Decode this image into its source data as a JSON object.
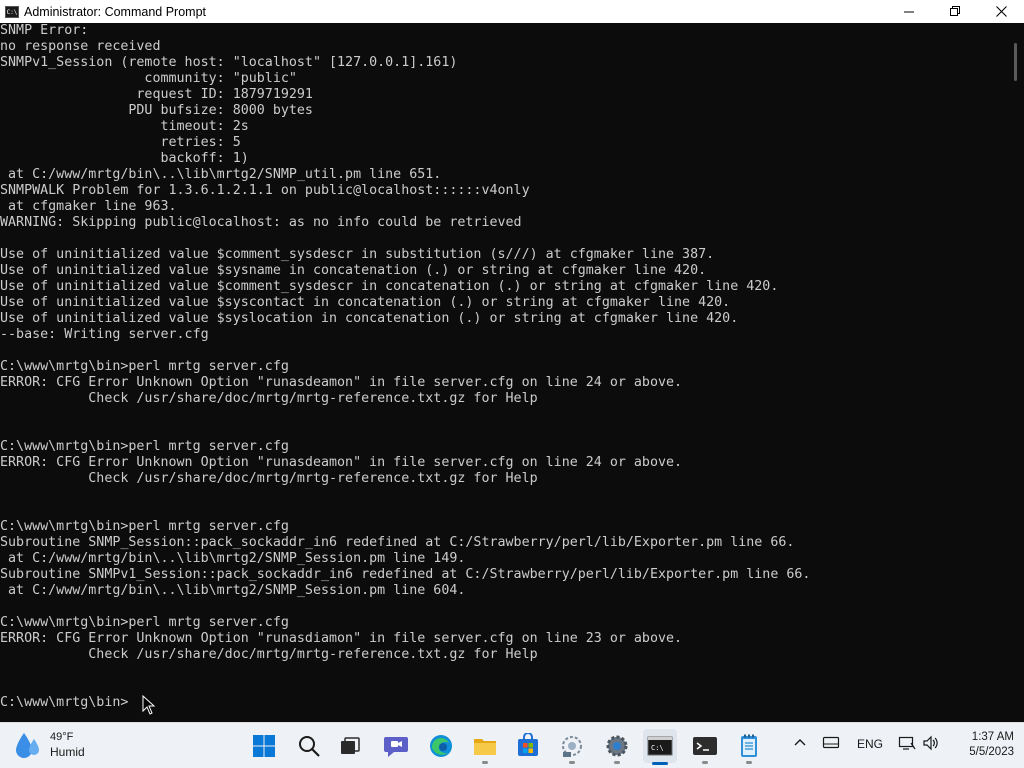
{
  "window": {
    "title": "Administrator: Command Prompt",
    "app_icon_text": "C:\\",
    "minimize": "—",
    "maximize": "❐",
    "close": "✕"
  },
  "console": {
    "lines": [
      "SNMP Error:",
      "no response received",
      "SNMPv1_Session (remote host: \"localhost\" [127.0.0.1].161)",
      "                  community: \"public\"",
      "                 request ID: 1879719291",
      "                PDU bufsize: 8000 bytes",
      "                    timeout: 2s",
      "                    retries: 5",
      "                    backoff: 1)",
      " at C:/www/mrtg/bin\\..\\lib\\mrtg2/SNMP_util.pm line 651.",
      "SNMPWALK Problem for 1.3.6.1.2.1.1 on public@localhost::::::v4only",
      " at cfgmaker line 963.",
      "WARNING: Skipping public@localhost: as no info could be retrieved",
      "",
      "Use of uninitialized value $comment_sysdescr in substitution (s///) at cfgmaker line 387.",
      "Use of uninitialized value $sysname in concatenation (.) or string at cfgmaker line 420.",
      "Use of uninitialized value $comment_sysdescr in concatenation (.) or string at cfgmaker line 420.",
      "Use of uninitialized value $syscontact in concatenation (.) or string at cfgmaker line 420.",
      "Use of uninitialized value $syslocation in concatenation (.) or string at cfgmaker line 420.",
      "--base: Writing server.cfg",
      "",
      "C:\\www\\mrtg\\bin>perl mrtg server.cfg",
      "ERROR: CFG Error Unknown Option \"runasdeamon\" in file server.cfg on line 24 or above.",
      "           Check /usr/share/doc/mrtg/mrtg-reference.txt.gz for Help",
      "",
      "",
      "C:\\www\\mrtg\\bin>perl mrtg server.cfg",
      "ERROR: CFG Error Unknown Option \"runasdeamon\" in file server.cfg on line 24 or above.",
      "           Check /usr/share/doc/mrtg/mrtg-reference.txt.gz for Help",
      "",
      "",
      "C:\\www\\mrtg\\bin>perl mrtg server.cfg",
      "Subroutine SNMP_Session::pack_sockaddr_in6 redefined at C:/Strawberry/perl/lib/Exporter.pm line 66.",
      " at C:/www/mrtg/bin\\..\\lib\\mrtg2/SNMP_Session.pm line 149.",
      "Subroutine SNMPv1_Session::pack_sockaddr_in6 redefined at C:/Strawberry/perl/lib/Exporter.pm line 66.",
      " at C:/www/mrtg/bin\\..\\lib\\mrtg2/SNMP_Session.pm line 604.",
      "",
      "C:\\www\\mrtg\\bin>perl mrtg server.cfg",
      "ERROR: CFG Error Unknown Option \"runasdiamon\" in file server.cfg on line 23 or above.",
      "           Check /usr/share/doc/mrtg/mrtg-reference.txt.gz for Help",
      "",
      "",
      "C:\\www\\mrtg\\bin>"
    ]
  },
  "taskbar": {
    "weather": {
      "temp": "49°F",
      "desc": "Humid",
      "icon": "raindrop-icon"
    },
    "apps": [
      {
        "name": "start-button",
        "icon": "windows-logo-icon"
      },
      {
        "name": "search-button",
        "icon": "search-icon"
      },
      {
        "name": "task-view-button",
        "icon": "task-view-icon"
      },
      {
        "name": "teams-chat-button",
        "icon": "chat-icon"
      },
      {
        "name": "edge-button",
        "icon": "edge-icon"
      },
      {
        "name": "file-explorer-button",
        "icon": "folder-icon"
      },
      {
        "name": "store-button",
        "icon": "store-icon"
      },
      {
        "name": "network-tool-button",
        "icon": "network-tool-icon"
      },
      {
        "name": "settings-button",
        "icon": "gear-icon"
      },
      {
        "name": "command-prompt-button",
        "icon": "cmd-icon"
      },
      {
        "name": "terminal-button",
        "icon": "terminal-icon"
      },
      {
        "name": "notepad-button",
        "icon": "notepad-icon"
      }
    ],
    "tray": {
      "chevron": "^",
      "language": "ENG",
      "time": "1:37 AM",
      "date": "5/5/2023"
    }
  },
  "colors": {
    "console_bg": "#0c0c0c",
    "console_fg": "#cccccc",
    "taskbar_bg": "#eef1f5",
    "accent": "#005fb8"
  }
}
